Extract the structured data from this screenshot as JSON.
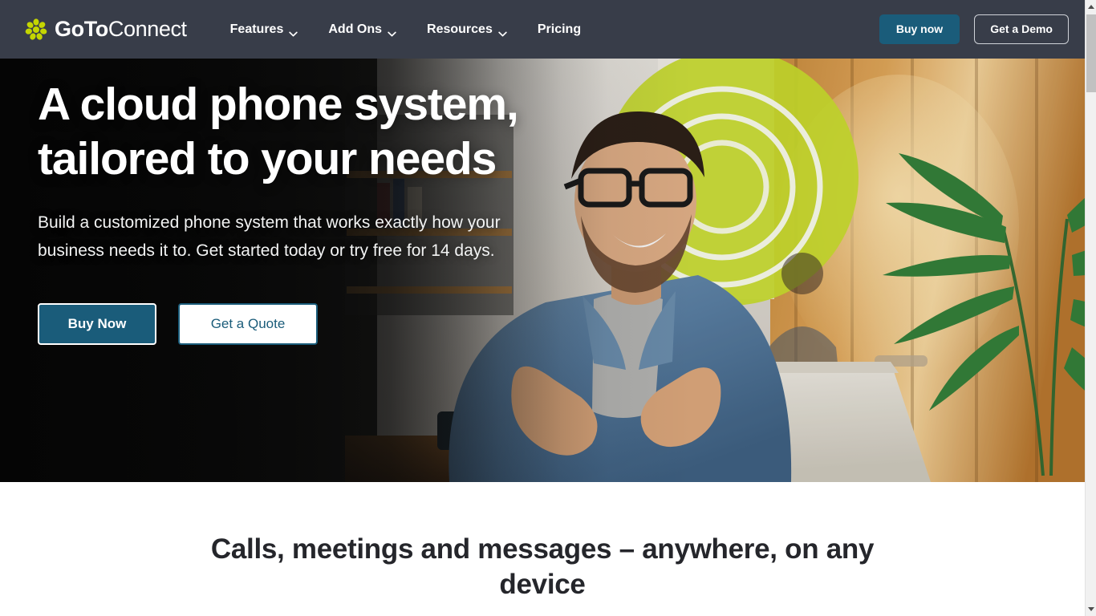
{
  "header": {
    "brand": {
      "name_bold": "GoTo",
      "name_light": "Connect",
      "logo_icon": "goto-flower-icon",
      "logo_color": "#c4d600"
    },
    "background_color": "#383d49",
    "nav": [
      {
        "label": "Features",
        "has_dropdown": true,
        "icon": "chevron-down-icon"
      },
      {
        "label": "Add Ons",
        "has_dropdown": true,
        "icon": "chevron-down-icon"
      },
      {
        "label": "Resources",
        "has_dropdown": true,
        "icon": "chevron-down-icon"
      },
      {
        "label": "Pricing",
        "has_dropdown": false
      }
    ],
    "buy_now_label": "Buy now",
    "get_demo_label": "Get a Demo",
    "accent_color": "#1a5c7a"
  },
  "hero": {
    "title": "A cloud phone system, tailored to your needs",
    "subtitle": "Build a customized phone system that works exactly how your business needs it to. Get started today or try free for 14 days.",
    "primary_cta": "Buy Now",
    "secondary_cta": "Get a Quote",
    "image_alt": "Smiling bearded man with glasses in a denim shirt gesturing at a laptop"
  },
  "section": {
    "heading": "Calls, meetings and messages – anywhere, on any device"
  },
  "scrollbar": {
    "up_icon": "scroll-up-arrow-icon",
    "down_icon": "scroll-down-arrow-icon",
    "thumb_color": "#c1c1c1",
    "track_color": "#f1f1f1"
  }
}
